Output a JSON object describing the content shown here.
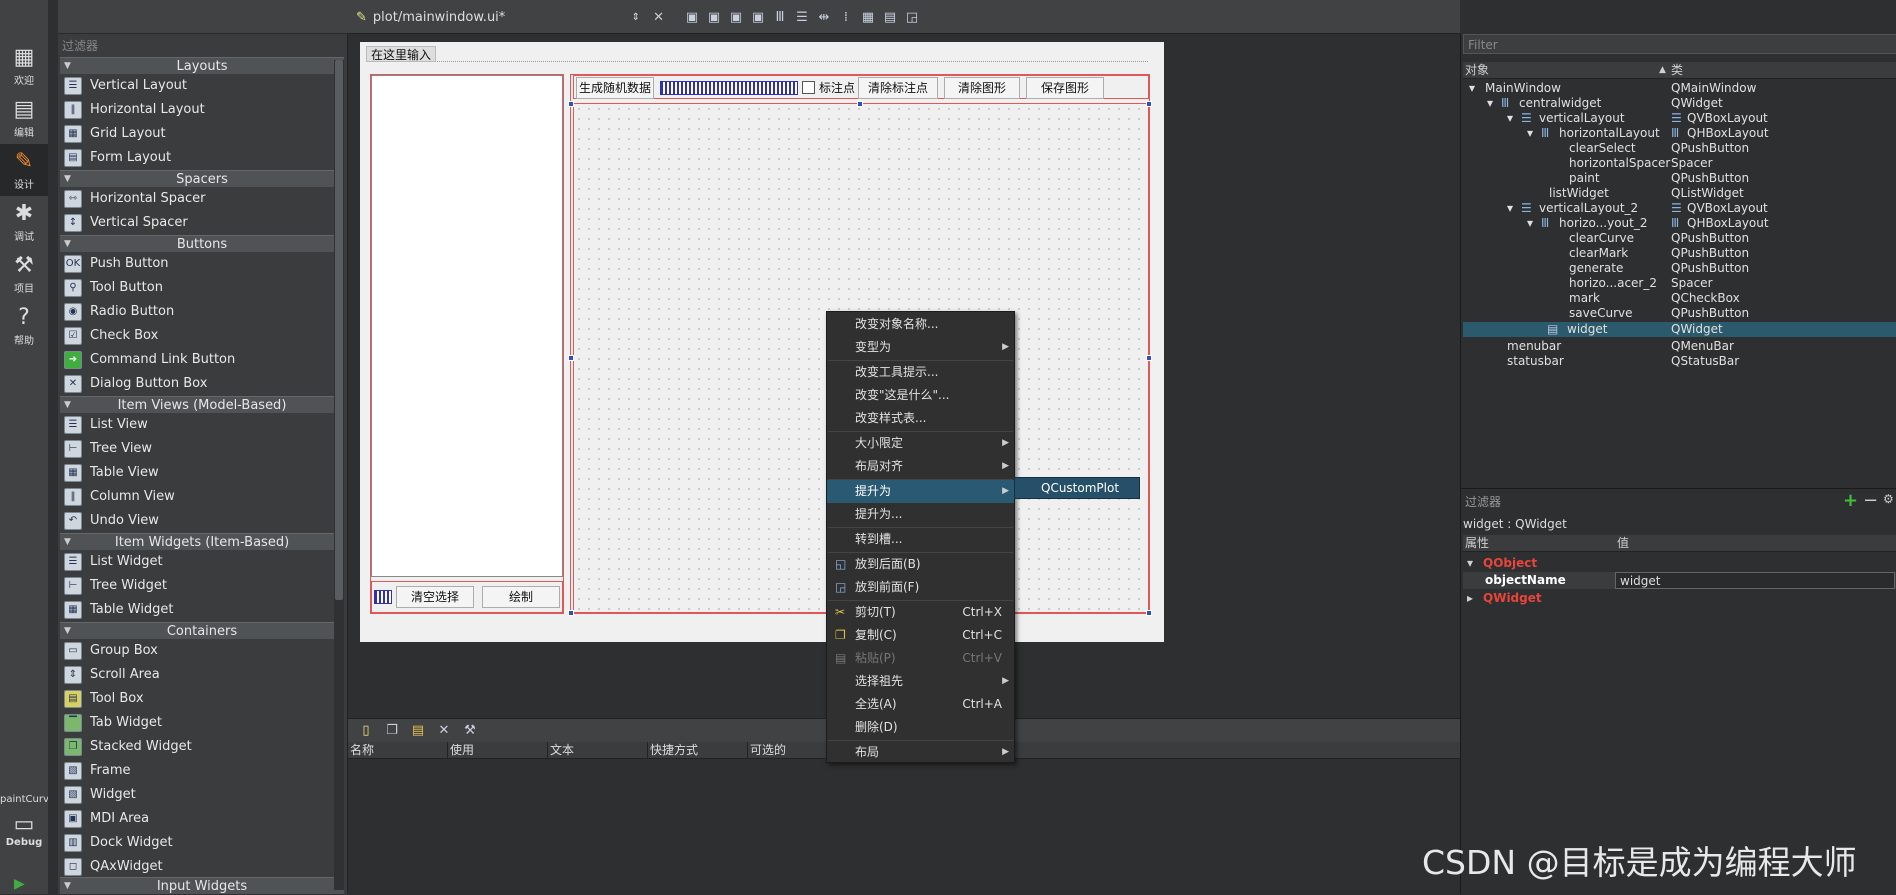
{
  "modes": [
    {
      "label": "欢迎",
      "icon": "grid-icon"
    },
    {
      "label": "编辑",
      "icon": "document-icon"
    },
    {
      "label": "设计",
      "icon": "pen-icon"
    },
    {
      "label": "调试",
      "icon": "bug-icon"
    },
    {
      "label": "项目",
      "icon": "wrench-icon"
    },
    {
      "label": "帮助",
      "icon": "help-icon"
    }
  ],
  "kit": {
    "target": "paintCurve",
    "build": "Debug"
  },
  "widget_box": {
    "filter_placeholder": "过滤器",
    "categories": {
      "layouts": "Layouts",
      "spacers": "Spacers",
      "buttons": "Buttons",
      "item_views": "Item Views (Model-Based)",
      "item_widgets": "Item Widgets (Item-Based)",
      "containers": "Containers",
      "input_widgets": "Input Widgets"
    },
    "items": [
      "Vertical Layout",
      "Horizontal Layout",
      "Grid Layout",
      "Form Layout",
      "Horizontal Spacer",
      "Vertical Spacer",
      "Push Button",
      "Tool Button",
      "Radio Button",
      "Check Box",
      "Command Link Button",
      "Dialog Button Box",
      "List View",
      "Tree View",
      "Table View",
      "Column View",
      "Undo View",
      "List Widget",
      "Tree Widget",
      "Table Widget",
      "Group Box",
      "Scroll Area",
      "Tool Box",
      "Tab Widget",
      "Stacked Widget",
      "Frame",
      "Widget",
      "MDI Area",
      "Dock Widget",
      "QAxWidget"
    ]
  },
  "editor": {
    "file_tab": "plot/mainwindow.ui*"
  },
  "form": {
    "menu_placeholder": "在这里输入",
    "buttons": {
      "clear_select": "清空选择",
      "paint": "绘制",
      "generate": "生成随机数据",
      "mark": "标注点",
      "clear_mark": "清除标注点",
      "clear_curve": "清除图形",
      "save_curve": "保存图形"
    }
  },
  "context_menu": {
    "items": [
      {
        "label": "改变对象名称..."
      },
      {
        "label": "变型为",
        "submenu": true
      },
      {
        "label": "改变工具提示..."
      },
      {
        "label": "改变\"这是什么\"..."
      },
      {
        "label": "改变样式表..."
      },
      {
        "label": "大小限定",
        "submenu": true
      },
      {
        "label": "布局对齐",
        "submenu": true
      },
      {
        "label": "提升为",
        "submenu": true
      },
      {
        "label": "提升为..."
      },
      {
        "label": "转到槽..."
      },
      {
        "label": "放到后面(B)"
      },
      {
        "label": "放到前面(F)"
      },
      {
        "label": "剪切(T)",
        "shortcut": "Ctrl+X"
      },
      {
        "label": "复制(C)",
        "shortcut": "Ctrl+C"
      },
      {
        "label": "粘贴(P)",
        "shortcut": "Ctrl+V"
      },
      {
        "label": "选择祖先",
        "submenu": true
      },
      {
        "label": "全选(A)",
        "shortcut": "Ctrl+A"
      },
      {
        "label": "删除(D)"
      },
      {
        "label": "布局",
        "submenu": true
      }
    ],
    "submenu_item": "QCustomPlot"
  },
  "action_editor": {
    "columns": [
      "名称",
      "使用",
      "文本",
      "快捷方式",
      "可选的"
    ]
  },
  "object_inspector": {
    "filter_placeholder": "Filter",
    "headers": [
      "对象",
      "类"
    ],
    "rows": [
      {
        "object": "MainWindow",
        "class": "QMainWindow"
      },
      {
        "object": "centralwidget",
        "class": "QWidget"
      },
      {
        "object": "verticalLayout",
        "class": "QVBoxLayout"
      },
      {
        "object": "horizontalLayout",
        "class": "QHBoxLayout"
      },
      {
        "object": "clearSelect",
        "class": "QPushButton"
      },
      {
        "object": "horizontalSpacer",
        "class": "Spacer"
      },
      {
        "object": "paint",
        "class": "QPushButton"
      },
      {
        "object": "listWidget",
        "class": "QListWidget"
      },
      {
        "object": "verticalLayout_2",
        "class": "QVBoxLayout"
      },
      {
        "object": "horizo...yout_2",
        "class": "QHBoxLayout"
      },
      {
        "object": "clearCurve",
        "class": "QPushButton"
      },
      {
        "object": "clearMark",
        "class": "QPushButton"
      },
      {
        "object": "generate",
        "class": "QPushButton"
      },
      {
        "object": "horizo...acer_2",
        "class": "Spacer"
      },
      {
        "object": "mark",
        "class": "QCheckBox"
      },
      {
        "object": "saveCurve",
        "class": "QPushButton"
      },
      {
        "object": "widget",
        "class": "QWidget"
      },
      {
        "object": "menubar",
        "class": "QMenuBar"
      },
      {
        "object": "statusbar",
        "class": "QStatusBar"
      }
    ]
  },
  "property_editor": {
    "filter_placeholder": "过滤器",
    "title": "widget : QWidget",
    "headers": [
      "属性",
      "值"
    ],
    "group_qobject": "QObject",
    "prop_name": "objectName",
    "prop_value": "widget",
    "group_qwidget": "QWidget"
  },
  "watermark": "CSDN @目标是成为编程大师"
}
